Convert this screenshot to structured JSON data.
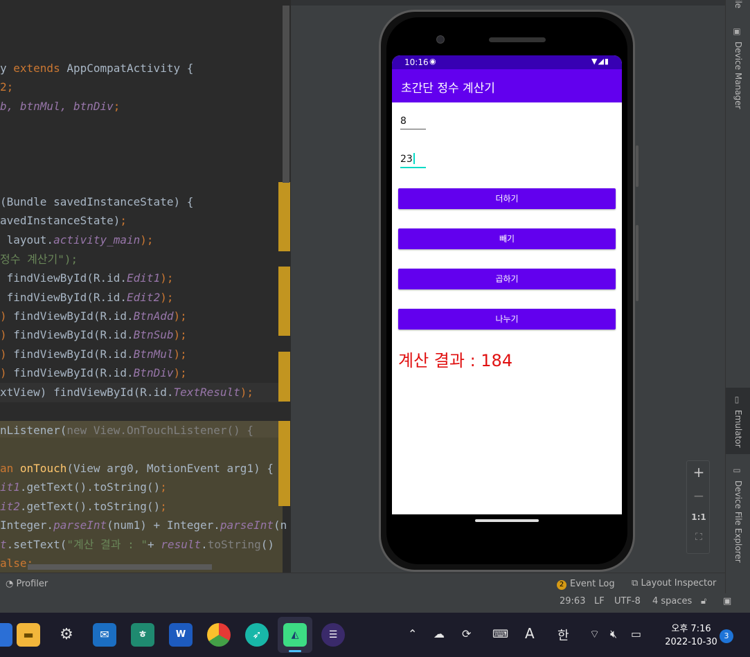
{
  "editor": {
    "lines": [
      {
        "segments": [
          {
            "t": "y ",
            "c": ""
          },
          {
            "t": "extends ",
            "c": "kw"
          },
          {
            "t": "AppCompatActivity {",
            "c": ""
          }
        ]
      },
      {
        "segments": [
          {
            "t": "2;",
            "c": "kw"
          }
        ]
      },
      {
        "segments": [
          {
            "t": "b, btnMul, btnDiv",
            "c": "it"
          },
          {
            "t": ";",
            "c": "kw"
          }
        ]
      },
      {
        "segments": [
          {
            "t": "(Bundle savedInstanceState) {",
            "c": ""
          }
        ]
      },
      {
        "segments": [
          {
            "t": "avedInstanceState)",
            "c": ""
          },
          {
            "t": ";",
            "c": "kw"
          }
        ]
      },
      {
        "segments": [
          {
            "t": " layout.",
            "c": ""
          },
          {
            "t": "activity_main",
            "c": "it"
          },
          {
            "t": ");",
            "c": "kw"
          }
        ]
      },
      {
        "segments": [
          {
            "t": "정수 계산기\");",
            "c": "str"
          }
        ]
      },
      {
        "segments": [
          {
            "t": " findViewById(R.id.",
            "c": ""
          },
          {
            "t": "Edit1",
            "c": "it"
          },
          {
            "t": ");",
            "c": "kw"
          }
        ]
      },
      {
        "segments": [
          {
            "t": " findViewById(R.id.",
            "c": ""
          },
          {
            "t": "Edit2",
            "c": "it"
          },
          {
            "t": ");",
            "c": "kw"
          }
        ]
      },
      {
        "segments": [
          {
            "t": ")",
            "c": "kw"
          },
          {
            "t": " findViewById(R.id.",
            "c": ""
          },
          {
            "t": "BtnAdd",
            "c": "it"
          },
          {
            "t": ");",
            "c": "kw"
          }
        ]
      },
      {
        "segments": [
          {
            "t": ")",
            "c": "kw"
          },
          {
            "t": " findViewById(R.id.",
            "c": ""
          },
          {
            "t": "BtnSub",
            "c": "it"
          },
          {
            "t": ");",
            "c": "kw"
          }
        ]
      },
      {
        "segments": [
          {
            "t": ")",
            "c": "kw"
          },
          {
            "t": " findViewById(R.id.",
            "c": ""
          },
          {
            "t": "BtnMul",
            "c": "it"
          },
          {
            "t": ");",
            "c": "kw"
          }
        ]
      },
      {
        "segments": [
          {
            "t": ")",
            "c": "kw"
          },
          {
            "t": " findViewById(R.id.",
            "c": ""
          },
          {
            "t": "BtnDiv",
            "c": "it"
          },
          {
            "t": ");",
            "c": "kw"
          }
        ]
      },
      {
        "segments": [
          {
            "t": "xtView) findViewById(R.id.",
            "c": ""
          },
          {
            "t": "TextResult",
            "c": "it"
          },
          {
            "t": ");",
            "c": "kw"
          }
        ]
      },
      {
        "segments": [
          {
            "t": "nListener(",
            "c": ""
          },
          {
            "t": "new View.OnTouchListener() {",
            "c": "dim"
          }
        ]
      },
      {
        "segments": [
          {
            "t": "an ",
            "c": "kw"
          },
          {
            "t": "onTouch",
            "c": "fn"
          },
          {
            "t": "(View arg0, MotionEvent arg1) {",
            "c": ""
          }
        ]
      },
      {
        "segments": [
          {
            "t": "it1",
            "c": "it"
          },
          {
            "t": ".getText().toString()",
            "c": ""
          },
          {
            "t": ";",
            "c": "kw"
          }
        ]
      },
      {
        "segments": [
          {
            "t": "it2",
            "c": "it"
          },
          {
            "t": ".getText().toString()",
            "c": ""
          },
          {
            "t": ";",
            "c": "kw"
          }
        ]
      },
      {
        "segments": [
          {
            "t": "Integer.",
            "c": ""
          },
          {
            "t": "parseInt",
            "c": "it"
          },
          {
            "t": "(num1) + Integer.",
            "c": ""
          },
          {
            "t": "parseInt",
            "c": "it"
          },
          {
            "t": "(n",
            "c": ""
          }
        ]
      },
      {
        "segments": [
          {
            "t": "t",
            "c": "it"
          },
          {
            "t": ".setText(",
            "c": ""
          },
          {
            "t": "\"계산 결과 : \"",
            "c": "str"
          },
          {
            "t": "+ ",
            "c": ""
          },
          {
            "t": "result",
            "c": "it"
          },
          {
            "t": ".",
            "c": ""
          },
          {
            "t": "toString",
            "c": "dim"
          },
          {
            "t": "()",
            "c": ""
          }
        ]
      },
      {
        "segments": [
          {
            "t": "alse;",
            "c": "kw"
          }
        ]
      }
    ]
  },
  "app": {
    "status_time": "10:16",
    "title": "초간단 정수 계산기",
    "edit1_value": "8",
    "edit2_value": "23",
    "btn_add": "더하기",
    "btn_sub": "빼기",
    "btn_mul": "곱하기",
    "btn_div": "나누기",
    "result": "계산 결과 : 184"
  },
  "zoom": {
    "in": "+",
    "out": "−",
    "one_to_one": "1:1"
  },
  "right_strip": {
    "top_partial": "ile",
    "device_manager": "Device Manager",
    "emulator": "Emulator",
    "device_file_explorer": "Device File Explorer"
  },
  "bottom_bar": {
    "profiler": "Profiler",
    "event_log_count": "2",
    "event_log": "Event Log",
    "layout_inspector": "Layout Inspector"
  },
  "status": {
    "position": "29:63",
    "line_sep": "LF",
    "encoding": "UTF-8",
    "indent": "4 spaces"
  },
  "taskbar": {
    "ime_mode": "A",
    "ime_lang": "한",
    "time": "오후 7:16",
    "date": "2022-10-30",
    "notifications": "3"
  },
  "colors": {
    "accent": "#6200ee",
    "status_bar": "#3700b3",
    "result_text": "#e01010",
    "edit_focus": "#03dac5"
  }
}
